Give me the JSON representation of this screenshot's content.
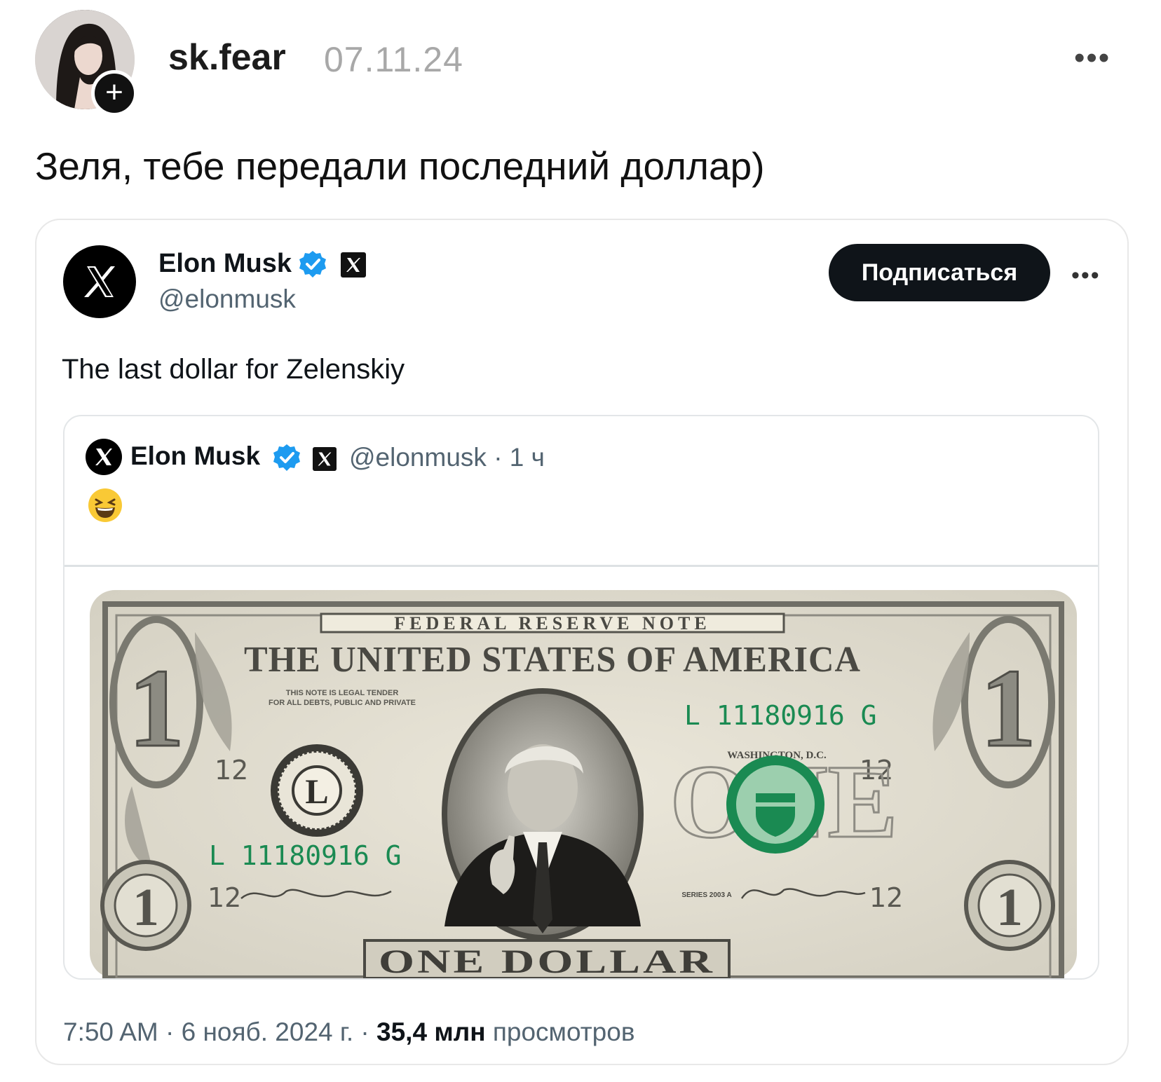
{
  "post": {
    "author": "sk.fear",
    "date": "07.11.24",
    "menu": "•••",
    "text": "Зеля, тебе передали последний доллар)"
  },
  "tweet": {
    "name": "Elon Musk",
    "handle": "@elonmusk",
    "subscribe_label": "Подписаться",
    "menu": "•••",
    "text": "The last dollar for Zelenskiy",
    "time": "7:50 AM · 6 нояб. 2024 г. · ",
    "views_count": "35,4 млн",
    "views_label": " просмотров"
  },
  "quote": {
    "name": "Elon Musk",
    "handle": "@elonmusk · 1 ч"
  },
  "banknote": {
    "top_banner": "FEDERAL RESERVE NOTE",
    "country": "THE UNITED STATES OF AMERICA",
    "legal_text_1": "THIS NOTE IS LEGAL TENDER",
    "legal_text_2": "FOR ALL DEBTS, PUBLIC AND PRIVATE",
    "serial": "L 11180916 G",
    "city": "WASHINGTON, D.C.",
    "district_letter": "L",
    "corner_digit": "1",
    "plate_number": "12",
    "denomination": "ONE DOLLAR",
    "series": "SERIES 2003 A"
  },
  "colors": {
    "accent_verified": "#1d9bf0",
    "note_green": "#1a8a52",
    "note_gray": "#6f6e66"
  }
}
